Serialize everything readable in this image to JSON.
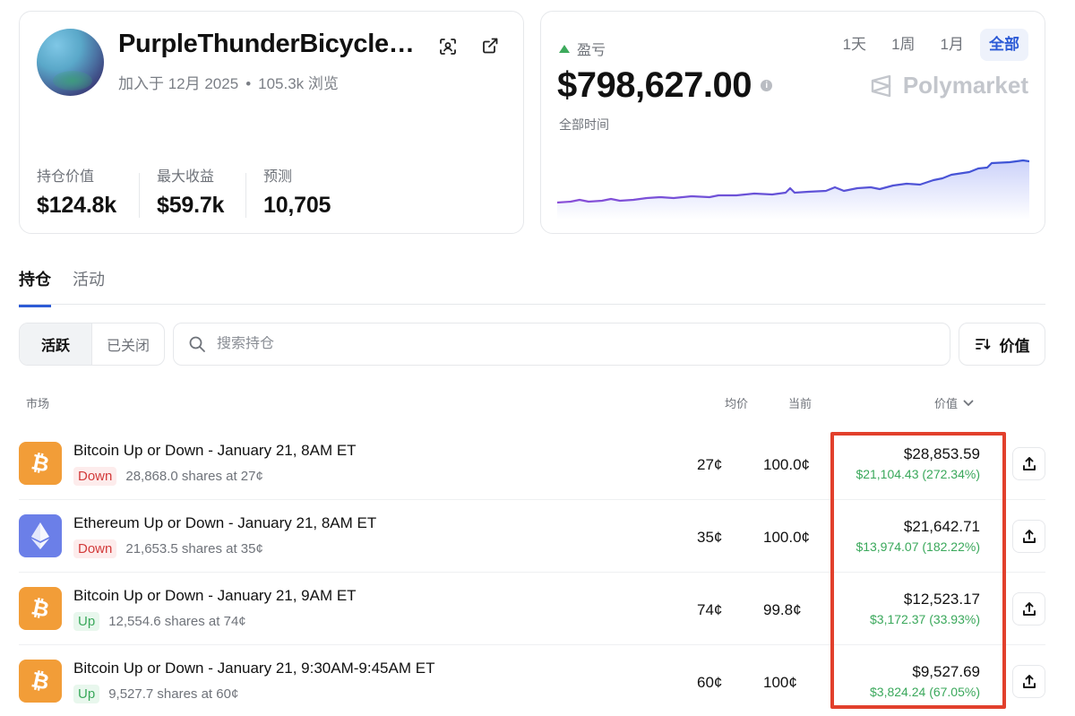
{
  "profile": {
    "username": "PurpleThunderBicycle…",
    "joined": "加入于 12月 2025",
    "views": "105.3k 浏览",
    "stats": [
      {
        "label": "持仓价值",
        "value": "$124.8k"
      },
      {
        "label": "最大收益",
        "value": "$59.7k"
      },
      {
        "label": "预测",
        "value": "10,705"
      }
    ]
  },
  "pnl": {
    "label": "盈亏",
    "value": "$798,627.00",
    "range_caption": "全部时间",
    "brand": "Polymarket",
    "ranges": [
      "1天",
      "1周",
      "1月",
      "全部"
    ],
    "active_range": "全部",
    "accent": "#5a4bd8"
  },
  "tabs": {
    "positions": "持仓",
    "activity": "活动"
  },
  "filters": {
    "active": "活跃",
    "closed": "已关闭"
  },
  "search": {
    "placeholder": "搜索持仓"
  },
  "sort": {
    "label": "价值"
  },
  "table": {
    "headers": {
      "market": "市场",
      "avg": "均价",
      "current": "当前",
      "value": "价值"
    },
    "rows": [
      {
        "icon": "bitcoin-icon",
        "title": "Bitcoin Up or Down - January 21, 8AM ET",
        "side": "Down",
        "shares": "28,868.0 shares at 27¢",
        "avg": "27¢",
        "current": "100.0¢",
        "value": "$28,853.59",
        "pnl": "$21,104.43 (272.34%)"
      },
      {
        "icon": "ethereum-icon",
        "title": "Ethereum Up or Down - January 21, 8AM ET",
        "side": "Down",
        "shares": "21,653.5 shares at 35¢",
        "avg": "35¢",
        "current": "100.0¢",
        "value": "$21,642.71",
        "pnl": "$13,974.07 (182.22%)"
      },
      {
        "icon": "bitcoin-icon",
        "title": "Bitcoin Up or Down - January 21, 9AM ET",
        "side": "Up",
        "shares": "12,554.6 shares at 74¢",
        "avg": "74¢",
        "current": "99.8¢",
        "value": "$12,523.17",
        "pnl": "$3,172.37 (33.93%)"
      },
      {
        "icon": "bitcoin-icon",
        "title": "Bitcoin Up or Down - January 21, 9:30AM-9:45AM ET",
        "side": "Up",
        "shares": "9,527.7 shares at 60¢",
        "avg": "60¢",
        "current": "100¢",
        "value": "$9,527.69",
        "pnl": "$3,824.24 (67.05%)"
      }
    ]
  },
  "colors": {
    "bitcoin": "#f29d38",
    "ethereum": "#6b7fe8",
    "positive": "#3aa85b",
    "negative": "#d23a3a",
    "highlight": "#e2402c"
  }
}
